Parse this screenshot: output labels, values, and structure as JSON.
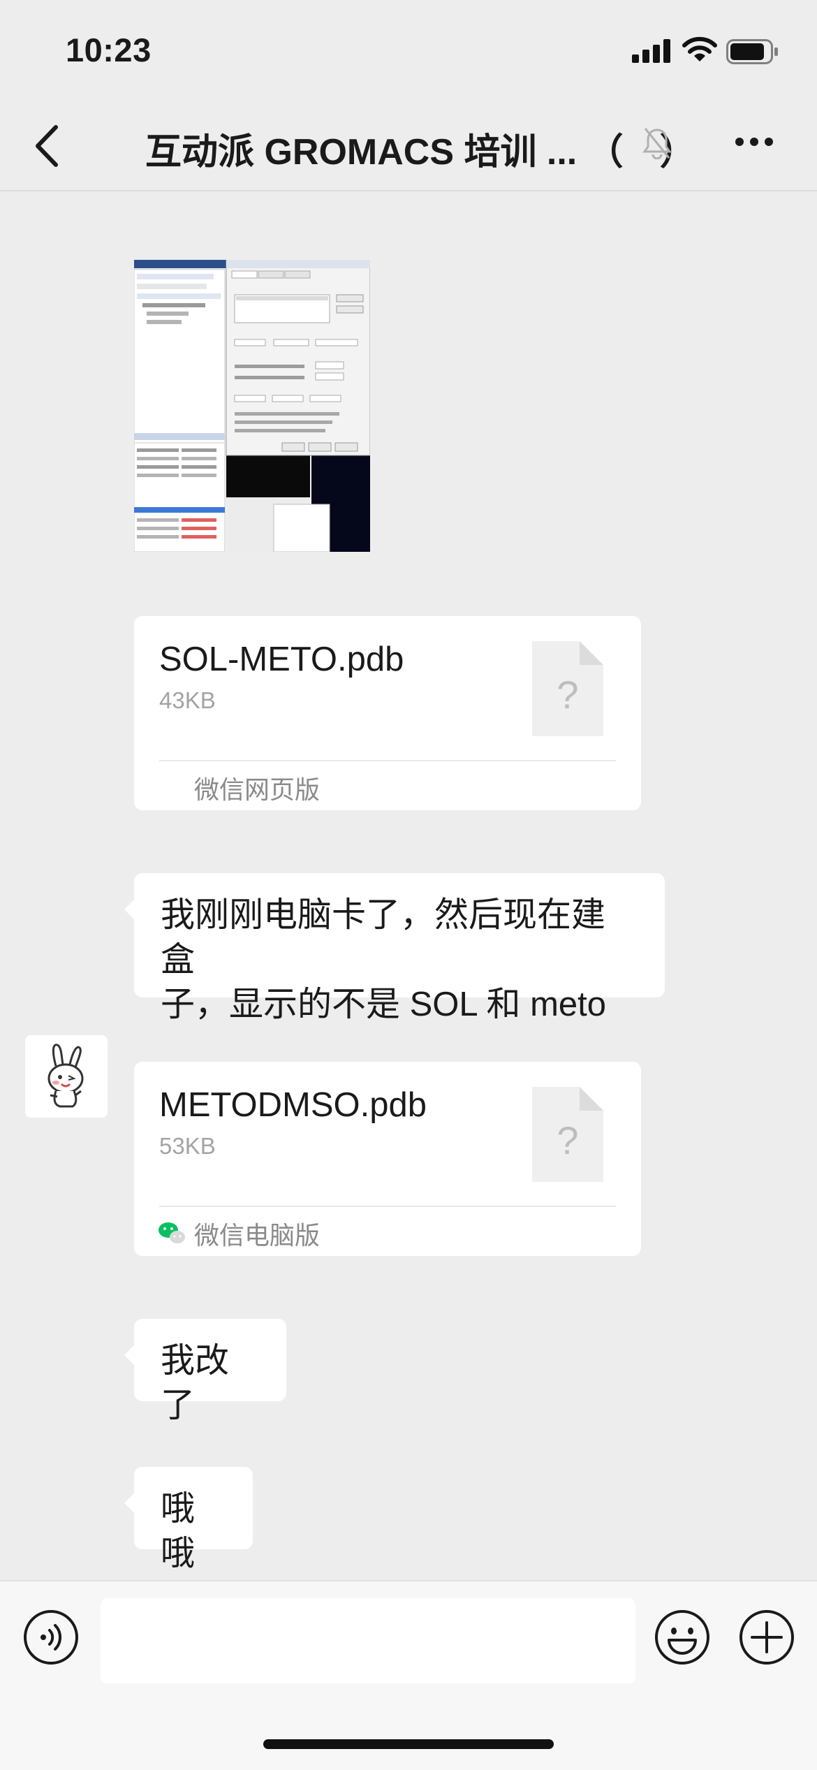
{
  "status_bar": {
    "time": "10:23"
  },
  "header": {
    "title": "互动派 GROMACS 培训 ... （　）"
  },
  "messages": [
    {
      "type": "image",
      "caption": ""
    },
    {
      "type": "file",
      "file_name": "SOL-METO.pdb",
      "file_size": "43KB",
      "source": "微信网页版"
    },
    {
      "type": "text",
      "text_line1": "我刚刚电脑卡了，然后现在建盒",
      "text_line2": "子，显示的不是 SOL 和 meto"
    },
    {
      "type": "file",
      "file_name": "METODMSO.pdb",
      "file_size": "53KB",
      "source": "微信电脑版"
    },
    {
      "type": "text",
      "text": "我改了"
    },
    {
      "type": "text",
      "text": "哦哦"
    }
  ],
  "file_icon_glyph": "?",
  "input_bar": {
    "placeholder": ""
  },
  "colors": {
    "background": "#ededed",
    "bubble": "#ffffff",
    "wechat_green": "#07c160"
  }
}
